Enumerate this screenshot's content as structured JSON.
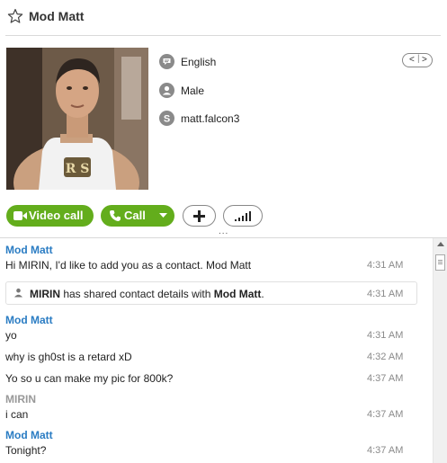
{
  "header": {
    "title": "Mod Matt"
  },
  "profile": {
    "language": "English",
    "gender": "Male",
    "skype_name": "matt.falcon3",
    "pager": {
      "prev": "<",
      "next": ">"
    }
  },
  "actions": {
    "video_call": "Video call",
    "call": "Call",
    "more_indicator": "..."
  },
  "colors": {
    "accent_green": "#63ad1c",
    "sender_blue": "#2a7cc3",
    "sender_gray": "#999999"
  },
  "chat": {
    "items": [
      {
        "sender": "Mod Matt",
        "text": "Hi MIRIN, I'd like to add you as a contact. Mod Matt",
        "time": "4:31 AM"
      },
      {
        "system_pre": "MIRIN",
        "system_mid": " has shared contact details with ",
        "system_post": "Mod Matt",
        "system_end": ".",
        "time": "4:31 AM"
      },
      {
        "sender": "Mod Matt",
        "text": "yo",
        "time": "4:31 AM"
      },
      {
        "text": "why is gh0st is a retard xD",
        "time": "4:32 AM"
      },
      {
        "text": "Yo so u can make my pic for 800k?",
        "time": "4:37 AM"
      },
      {
        "sender": "MIRIN",
        "text": "i can",
        "time": "4:37 AM"
      },
      {
        "sender": "Mod Matt",
        "text": "Tonight?",
        "time": "4:37 AM"
      }
    ]
  }
}
